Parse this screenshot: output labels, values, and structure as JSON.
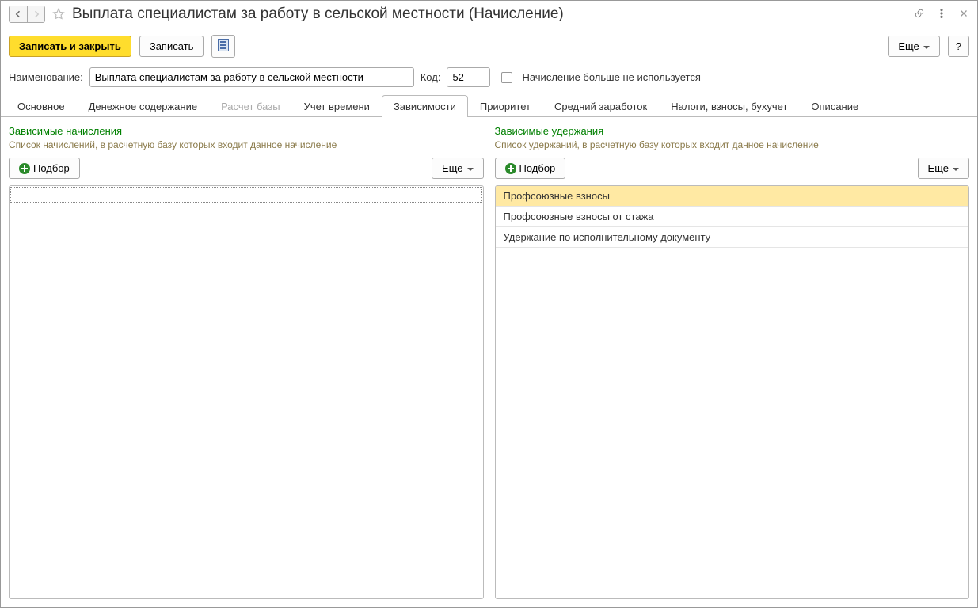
{
  "header": {
    "title": "Выплата специалистам за работу в сельской местности (Начисление)"
  },
  "toolbar": {
    "save_close": "Записать и закрыть",
    "save": "Записать",
    "more": "Еще",
    "help": "?"
  },
  "form": {
    "name_label": "Наименование:",
    "name_value": "Выплата специалистам за работу в сельской местности",
    "code_label": "Код:",
    "code_value": "52",
    "unused_label": "Начисление больше не используется"
  },
  "tabs": {
    "t0": "Основное",
    "t1": "Денежное содержание",
    "t2": "Расчет базы",
    "t3": "Учет времени",
    "t4": "Зависимости",
    "t5": "Приоритет",
    "t6": "Средний заработок",
    "t7": "Налоги, взносы, бухучет",
    "t8": "Описание"
  },
  "left_pane": {
    "title": "Зависимые начисления",
    "desc": "Список начислений, в расчетную базу которых входит данное начисление",
    "select_btn": "Подбор",
    "more": "Еще"
  },
  "right_pane": {
    "title": "Зависимые удержания",
    "desc": "Список удержаний, в расчетную базу которых входит данное начисление",
    "select_btn": "Подбор",
    "more": "Еще",
    "items": {
      "i0": "Профсоюзные взносы",
      "i1": "Профсоюзные взносы от стажа",
      "i2": "Удержание по исполнительному документу"
    }
  }
}
